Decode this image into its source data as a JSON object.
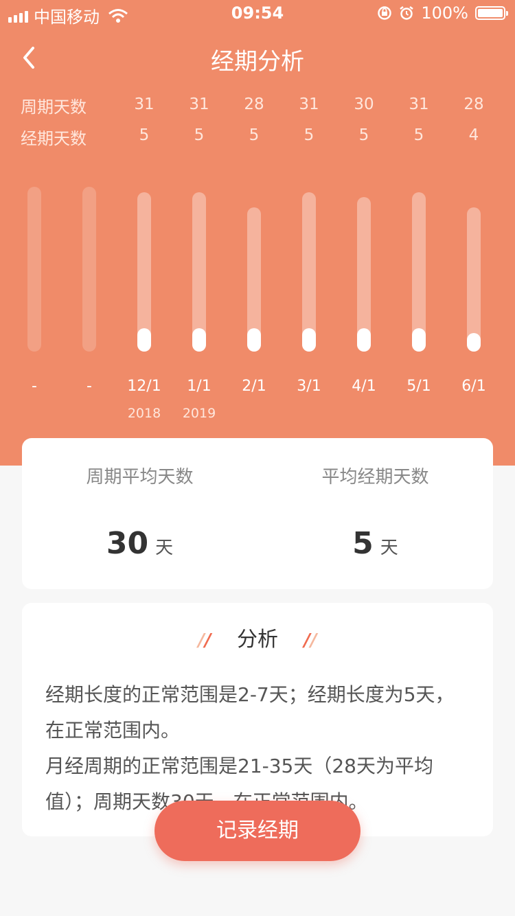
{
  "status_bar": {
    "carrier": "中国移动",
    "time": "09:54",
    "battery": "100%"
  },
  "header": {
    "title": "经期分析",
    "back_icon": "chevron-left-icon"
  },
  "table": {
    "cycle_label": "周期天数",
    "period_label": "经期天数",
    "cycle_values": [
      "31",
      "31",
      "28",
      "31",
      "30",
      "31",
      "28"
    ],
    "period_values": [
      "5",
      "5",
      "5",
      "5",
      "5",
      "5",
      "4"
    ]
  },
  "chart_data": {
    "type": "bar",
    "categories": [
      "-",
      "-",
      "12/1",
      "1/1",
      "2/1",
      "3/1",
      "4/1",
      "5/1",
      "6/1"
    ],
    "year_labels": [
      "",
      "",
      "2018",
      "2019",
      "",
      "",
      "",
      "",
      ""
    ],
    "cycle_days": [
      null,
      null,
      31,
      31,
      28,
      31,
      30,
      31,
      28
    ],
    "period_days": [
      null,
      null,
      5,
      5,
      5,
      5,
      5,
      5,
      4
    ]
  },
  "summary": {
    "avg_cycle_label": "周期平均天数",
    "avg_cycle_value": "30",
    "avg_cycle_unit": "天",
    "avg_period_label": "平均经期天数",
    "avg_period_value": "5",
    "avg_period_unit": "天"
  },
  "analysis": {
    "title": "分析",
    "line1": "经期长度的正常范围是2-7天；经期长度为5天，在正常范围内。",
    "line2": "月经周期的正常范围是21-35天（28天为平均值）；周期天数30天，在正常范围内。"
  },
  "record_button": "记录经期",
  "colors": {
    "header_bg": "#f08b69",
    "button_bg": "#ee6c5b",
    "page_bg": "#f7f7f7"
  }
}
